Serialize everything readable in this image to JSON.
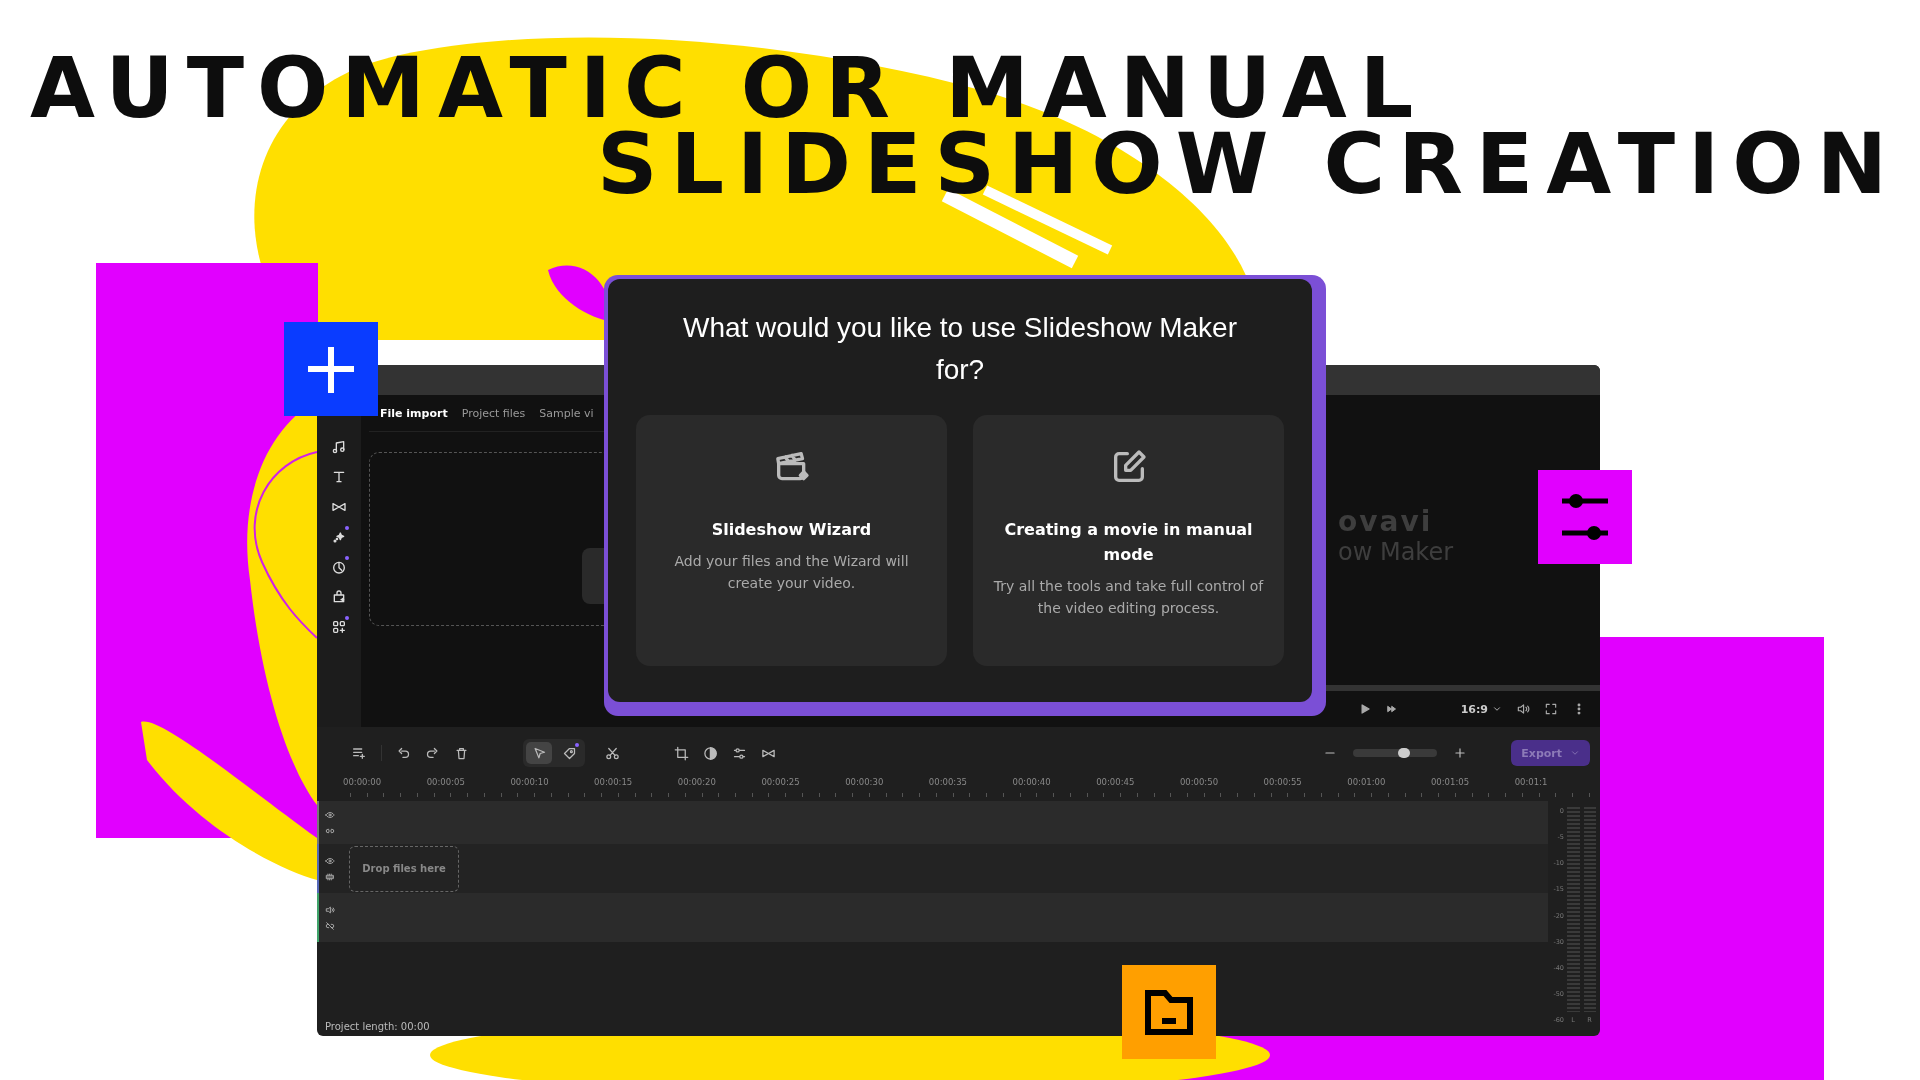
{
  "headline": {
    "line_1": "AUTOMATIC OR MANUAL",
    "line_2": "SLIDESHOW CREATION"
  },
  "app": {
    "sidebar": [
      {
        "selected": false,
        "new": false
      },
      {
        "selected": false,
        "new": false
      },
      {
        "selected": false,
        "new": false
      },
      {
        "selected": false,
        "new": true
      },
      {
        "selected": false,
        "new": true
      },
      {
        "selected": false,
        "new": false
      },
      {
        "selected": false,
        "new": true
      }
    ],
    "import_tabs": [
      {
        "label": "File import",
        "selected": true
      },
      {
        "label": "Project files",
        "selected": false
      },
      {
        "label": "Sample vi",
        "selected": false
      }
    ],
    "preview_logo": [
      "ovavi",
      "ow Maker"
    ],
    "player": {
      "aspect_ratio": "16:9"
    },
    "edit_modes": [
      {
        "selected": true,
        "new": false
      },
      {
        "selected": false,
        "new": true
      }
    ],
    "zoom": {
      "level": 0.6
    },
    "export_button": {
      "label": "Export",
      "disabled": true
    },
    "ruler": [
      "00:00:00",
      "00:00:05",
      "00:00:10",
      "00:00:15",
      "00:00:20",
      "00:00:25",
      "00:00:30",
      "00:00:35",
      "00:00:40",
      "00:00:45",
      "00:00:50",
      "00:00:55",
      "00:01:00",
      "00:01:05",
      "00:01:1"
    ],
    "tracks": [
      {
        "kind": "video"
      },
      {
        "kind": "main",
        "drop_hint": "Drop files here"
      },
      {
        "kind": "audio"
      }
    ],
    "meter": {
      "scale": [
        "0",
        "-5",
        "-10",
        "-15",
        "-20",
        "-30",
        "-40",
        "-50",
        "-60"
      ],
      "channels": [
        "L",
        "R"
      ]
    },
    "project_length": "Project length: 00:00"
  },
  "dialog": {
    "title": "What would you like to use Slideshow Maker for?",
    "options": [
      {
        "kind": "wizard",
        "title": "Slideshow Wizard",
        "description": "Add your files and the Wizard will create your video."
      },
      {
        "kind": "manual",
        "title": "Creating a movie in manual mode",
        "description": "Try all the tools and take full control of the video editing process."
      }
    ]
  }
}
